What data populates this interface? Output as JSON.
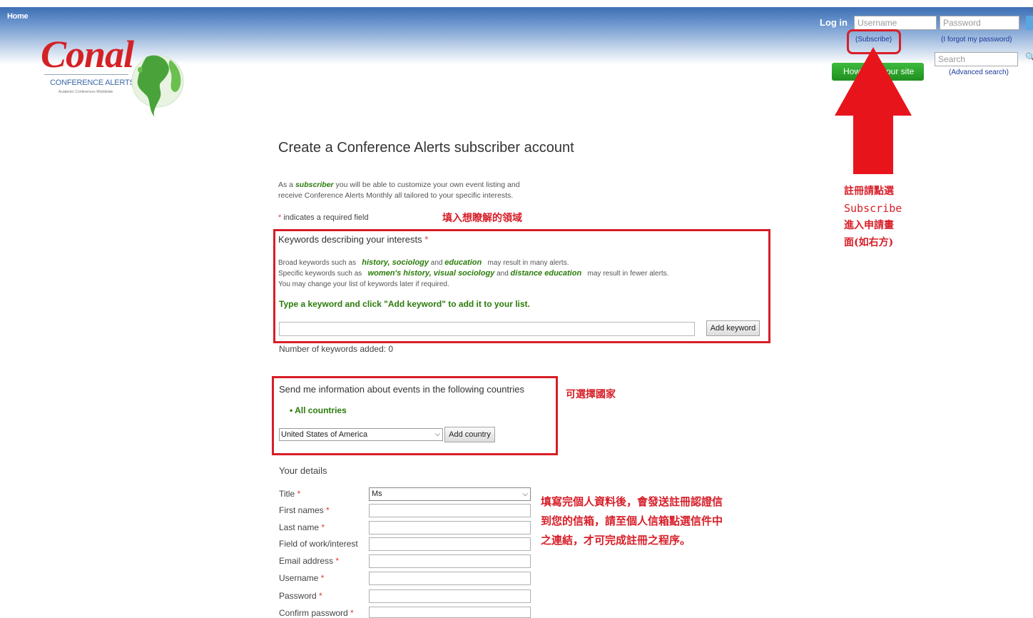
{
  "header": {
    "home": "Home",
    "log_in": "Log in",
    "username_placeholder": "Username",
    "password_placeholder": "Password",
    "subscribe_link": "(Subscribe)",
    "forgot_link": "(I forgot my password)",
    "search_placeholder": "Search",
    "advanced_search": "(Advanced search)",
    "green_button_left": "How",
    "green_button_right": "our site"
  },
  "logo": {
    "word": "Conal",
    "subtitle": "CONFERENCE ALERTS",
    "tagline": "Academic Conferences Worldwide"
  },
  "page": {
    "title": "Create a Conference Alerts subscriber account",
    "intro_prefix": "As a ",
    "intro_subscriber": "subscriber",
    "intro_suffix": " you will be able to customize your own event listing and",
    "intro_line2": "receive Conference Alerts Monthly all tailored to your specific interests.",
    "required_asterisk": "*",
    "required_note": " indicates a required field"
  },
  "keywords": {
    "heading": "Keywords describing your interests",
    "line1_prefix": "Broad keywords such as ",
    "line1_ex1": "history",
    "line1_ex2": "sociology",
    "line1_and": " and ",
    "line1_ex3": "education",
    "line1_suffix": " may result in many alerts.",
    "line2_prefix": "Specific keywords such as ",
    "line2_ex1": "women's history",
    "line2_ex2": "visual sociology",
    "line2_and": " and ",
    "line2_ex3": "distance education",
    "line2_suffix": " may result in fewer alerts.",
    "line3": "You may change your list of keywords later if required.",
    "instruction": "Type a keyword and click \"Add keyword\" to add it to your list.",
    "add_button": "Add keyword",
    "count_label": "Number of keywords added: 0"
  },
  "countries": {
    "heading": "Send me information about events in the following countries",
    "all_countries": "• All countries",
    "selected": "United States of America",
    "add_button": "Add country"
  },
  "details": {
    "heading": "Your details",
    "title_label": "Title",
    "title_value": "Ms",
    "first_names": "First names",
    "last_name": "Last name",
    "field": "Field of work/interest",
    "email": "Email address",
    "username": "Username",
    "password": "Password",
    "confirm_password": "Confirm password"
  },
  "annotations": {
    "keywords_note": "填入想瞭解的領域",
    "country_note": "可選擇國家",
    "details_line1": "填寫完個人資料後，會發送註冊認證信",
    "details_line2": "到您的信箱，請至個人信箱點選信件中",
    "details_line3": "之連結，才可完成註冊之程序。",
    "subscribe_line1": "註冊請點選",
    "subscribe_line2": "Subscribe",
    "subscribe_line3": "進入申請畫",
    "subscribe_line4": "面(如右方)"
  },
  "colors": {
    "annotation_red": "#d71e28",
    "green_text": "#2a7b0a",
    "header_blue": "#3d6fb3",
    "logo_red": "#d42126"
  },
  "icons": [
    "globe-icon",
    "search-icon",
    "go-icon",
    "chevron-down-icon",
    "arrow-up-icon"
  ]
}
